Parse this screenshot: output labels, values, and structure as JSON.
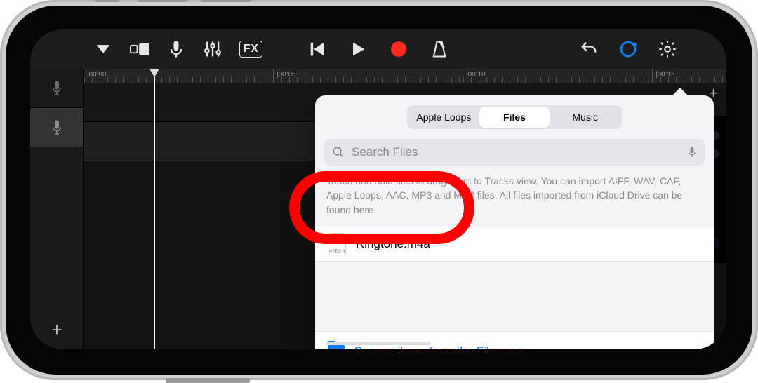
{
  "toolbar": {
    "fx_label": "FX"
  },
  "ruler": {
    "marks": [
      "|00:00",
      "|00:05",
      "|00:10",
      "|00:15"
    ]
  },
  "popover": {
    "tabs": {
      "loops": "Apple Loops",
      "files": "Files",
      "music": "Music"
    },
    "search_placeholder": "Search Files",
    "hint": "Touch and hold files to drag them to Tracks view. You can import AIFF, WAV, CAF, Apple Loops, AAC, MP3 and MIDI files. All files imported from iCloud Drive can be found here.",
    "file": {
      "name": "Ringtone.m4a",
      "type_label": "MPEG 4"
    },
    "browse_label": "Browse items from the Files app"
  }
}
